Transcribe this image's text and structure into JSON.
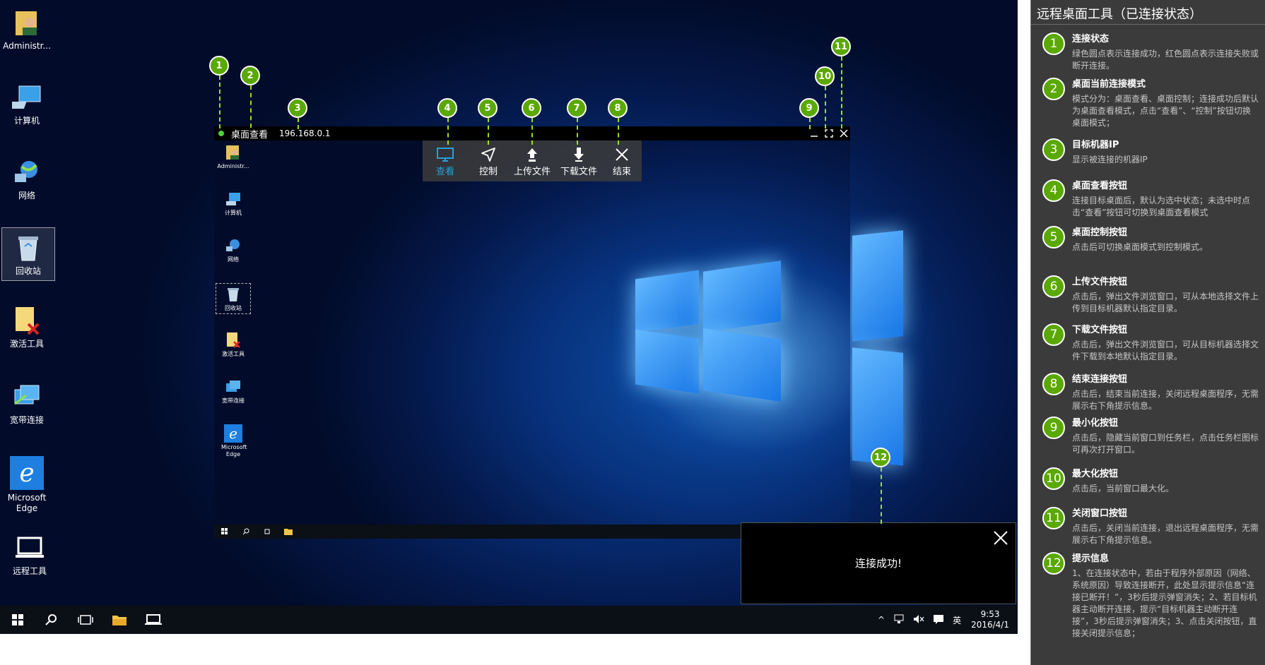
{
  "desktop": {
    "icons": [
      {
        "label": "Administr...",
        "icon": "user-folder-icon"
      },
      {
        "label": "计算机",
        "icon": "computer-icon"
      },
      {
        "label": "网络",
        "icon": "network-icon"
      },
      {
        "label": "回收站",
        "icon": "recycle-bin-icon"
      },
      {
        "label": "激活工具",
        "icon": "activation-tool-icon"
      },
      {
        "label": "宽带连接",
        "icon": "broadband-icon"
      },
      {
        "label": "Microsoft Edge",
        "icon": "edge-icon"
      },
      {
        "label": "远程工具",
        "icon": "remote-tool-icon"
      }
    ]
  },
  "taskbar": {
    "ime": "英",
    "time": "9:53",
    "date": "2016/4/1"
  },
  "remote_window": {
    "mode": "桌面查看",
    "ip": "196.168.0.1",
    "screen_icons": [
      {
        "label": "Administr..."
      },
      {
        "label": "计算机"
      },
      {
        "label": "网络"
      },
      {
        "label": "回收站"
      },
      {
        "label": "激活工具"
      },
      {
        "label": "宽带连接"
      },
      {
        "label": "Microsoft Edge"
      }
    ]
  },
  "toolbar": {
    "view": "查看",
    "control": "控制",
    "upload": "上传文件",
    "download": "下载文件",
    "end": "结束"
  },
  "toast": {
    "message": "连接成功!"
  },
  "callouts": [
    "1",
    "2",
    "3",
    "4",
    "5",
    "6",
    "7",
    "8",
    "9",
    "10",
    "11",
    "12"
  ],
  "panel": {
    "title": "远程桌面工具（已连接状态）",
    "items": [
      {
        "num": "1",
        "title": "连接状态",
        "desc": "绿色圆点表示连接成功，红色圆点表示连接失败或断开连接。"
      },
      {
        "num": "2",
        "title": "桌面当前连接模式",
        "desc": "模式分为：桌面查看、桌面控制；连接成功后默认为桌面查看模式，点击“查看”、“控制”按钮切换桌面模式；"
      },
      {
        "num": "3",
        "title": "目标机器IP",
        "desc": "显示被连接的机器IP"
      },
      {
        "num": "4",
        "title": "桌面查看按钮",
        "desc": "连接目标桌面后，默认为选中状态；未选中时点击“查看”按钮可切换到桌面查看模式"
      },
      {
        "num": "5",
        "title": "桌面控制按钮",
        "desc": "点击后可切换桌面模式到控制模式。"
      },
      {
        "num": "6",
        "title": "上传文件按钮",
        "desc": "点击后，弹出文件浏览窗口，可从本地选择文件上传到目标机器默认指定目录。"
      },
      {
        "num": "7",
        "title": "下载文件按钮",
        "desc": "点击后，弹出文件浏览窗口，可从目标机器选择文件下载到本地默认指定目录。"
      },
      {
        "num": "8",
        "title": "结束连接按钮",
        "desc": "点击后，结束当前连接，关闭远程桌面程序，无需展示右下角提示信息。"
      },
      {
        "num": "9",
        "title": "最小化按钮",
        "desc": "点击后，隐藏当前窗口到任务栏，点击任务栏图标可再次打开窗口。"
      },
      {
        "num": "10",
        "title": "最大化按钮",
        "desc": "点击后，当前窗口最大化。"
      },
      {
        "num": "11",
        "title": "关闭窗口按钮",
        "desc": "点击后，关闭当前连接，退出远程桌面程序，无需展示右下角提示信息。"
      },
      {
        "num": "12",
        "title": "提示信息",
        "desc": "1、在连接状态中，若由于程序外部原因（网络、系统原因）导致连接断开，此处显示提示信息“连接已断开！”，3秒后提示弹窗消失；2、若目标机器主动断开连接，提示“目标机器主动断开连接”，3秒后提示弹窗消失；3、点击关闭按钮，直接关闭提示信息；"
      }
    ]
  }
}
